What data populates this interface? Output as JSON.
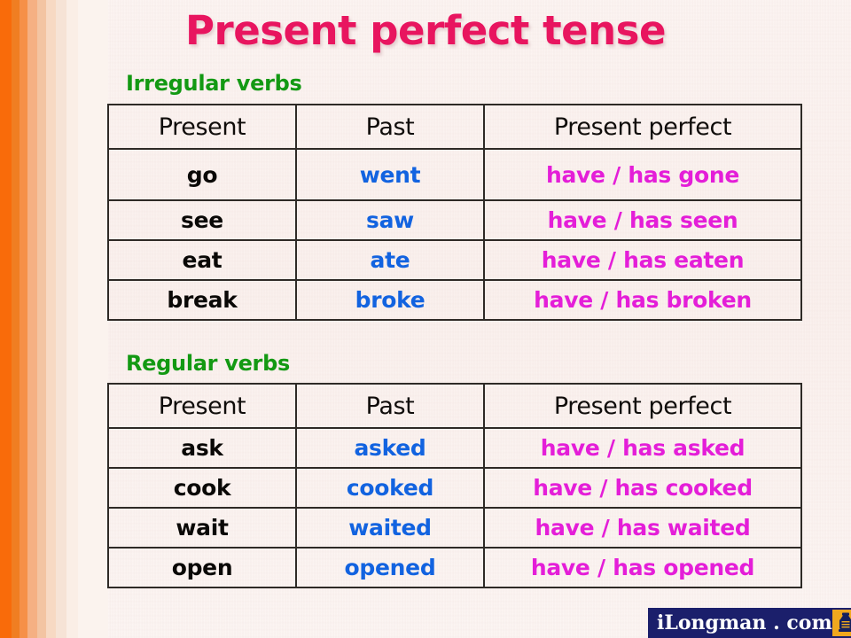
{
  "slide": {
    "title": "Present perfect tense",
    "title_color": "#e8155f",
    "background_color": "#fcf4f1"
  },
  "decor": {
    "stripes": [
      {
        "name": "stripe-1",
        "color": "#f96b0a",
        "width": 13
      },
      {
        "name": "stripe-2",
        "color": "#f07e22",
        "width": 9
      },
      {
        "name": "stripe-3",
        "color": "#f69048",
        "width": 9
      },
      {
        "name": "stripe-4",
        "color": "#f5b083",
        "width": 11
      },
      {
        "name": "stripe-5",
        "color": "#f3c4a2",
        "width": 10
      },
      {
        "name": "stripe-6",
        "color": "#f7d9c3",
        "width": 11
      },
      {
        "name": "stripe-7",
        "color": "#f6e3d6",
        "width": 12
      },
      {
        "name": "stripe-8",
        "color": "#faeee6",
        "width": 13
      },
      {
        "name": "stripe-9",
        "color": "#fbf3ee",
        "width": 34
      }
    ]
  },
  "sections": {
    "irregular": {
      "label": "Irregular verbs",
      "label_color": "#139913",
      "headers": {
        "present": "Present",
        "past": "Past",
        "perfect": "Present perfect"
      },
      "rows": [
        {
          "present": "go",
          "past": "went",
          "perfect": "have / has gone"
        },
        {
          "present": "see",
          "past": "saw",
          "perfect": "have / has seen"
        },
        {
          "present": "eat",
          "past": "ate",
          "perfect": "have / has eaten"
        },
        {
          "present": "break",
          "past": "broke",
          "perfect": "have / has broken"
        }
      ]
    },
    "regular": {
      "label": "Regular verbs",
      "label_color": "#139913",
      "headers": {
        "present": "Present",
        "past": "Past",
        "perfect": "Present perfect"
      },
      "rows": [
        {
          "present": "ask",
          "past": "asked",
          "perfect": "have / has asked"
        },
        {
          "present": "cook",
          "past": "cooked",
          "perfect": "have / has cooked"
        },
        {
          "present": "wait",
          "past": "waited",
          "perfect": "have / has waited"
        },
        {
          "present": "open",
          "past": "opened",
          "perfect": "have / has opened"
        }
      ]
    }
  },
  "colors": {
    "present_text": "#0a0806",
    "past_text": "#1263e0",
    "perfect_text": "#e41ed8",
    "table_border": "#2e2a26"
  },
  "footer": {
    "logo_text": "iLongman . com",
    "logo_background": "#1b1f6b",
    "logo_mark_background": "#f0a81e",
    "logo_mark_icon": "longman-lamp-icon"
  }
}
